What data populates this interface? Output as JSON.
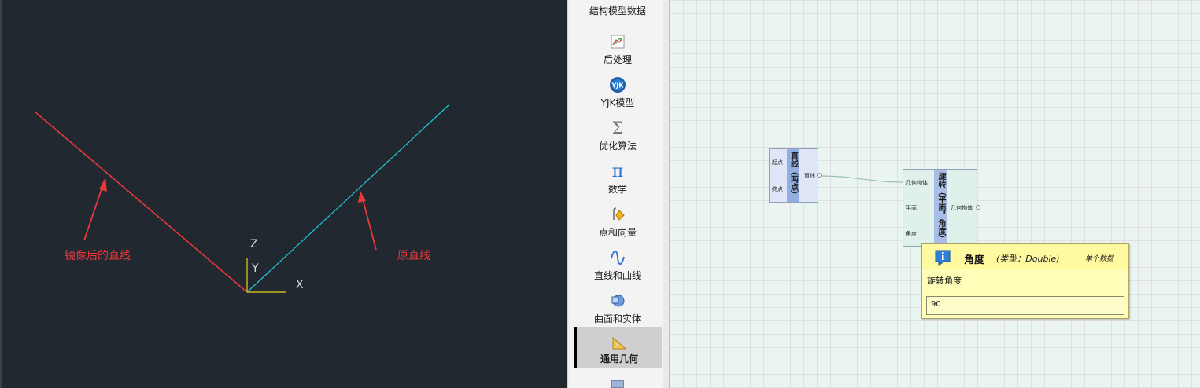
{
  "viewport": {
    "annotation_mirrored": "镜像后的直线",
    "annotation_original": "原直线",
    "axis_z": "Z",
    "axis_y": "Y",
    "axis_x": "X",
    "colors": {
      "background": "#212830",
      "mirrored_line": "#e8393a",
      "original_line": "#22c6d8",
      "axis_y": "#e8d21a"
    }
  },
  "toolbox": {
    "items": [
      {
        "label": "结构模型数据",
        "icon": "structure-model-icon"
      },
      {
        "label": "后处理",
        "icon": "post-process-icon"
      },
      {
        "label": "YJK模型",
        "icon": "yjk-model-icon"
      },
      {
        "label": "优化算法",
        "icon": "sigma-icon"
      },
      {
        "label": "数学",
        "icon": "pi-icon"
      },
      {
        "label": "点和向量",
        "icon": "point-vector-icon"
      },
      {
        "label": "直线和曲线",
        "icon": "curve-icon"
      },
      {
        "label": "曲面和实体",
        "icon": "surface-solid-icon"
      },
      {
        "label": "通用几何",
        "icon": "set-square-icon",
        "active": true
      }
    ]
  },
  "canvas": {
    "node_line": {
      "title": "直线（两点）",
      "inputs": [
        "起点",
        "终点"
      ],
      "outputs": [
        "直线"
      ]
    },
    "node_rotate": {
      "title": "旋转（平面，角度）",
      "inputs": [
        "几何物体",
        "平面",
        "角度"
      ],
      "outputs": [
        "几何物体"
      ]
    },
    "tooltip": {
      "name": "角度",
      "type": "(类型：Double)",
      "access": "单个数据",
      "description": "旋转角度",
      "value": "90"
    }
  }
}
